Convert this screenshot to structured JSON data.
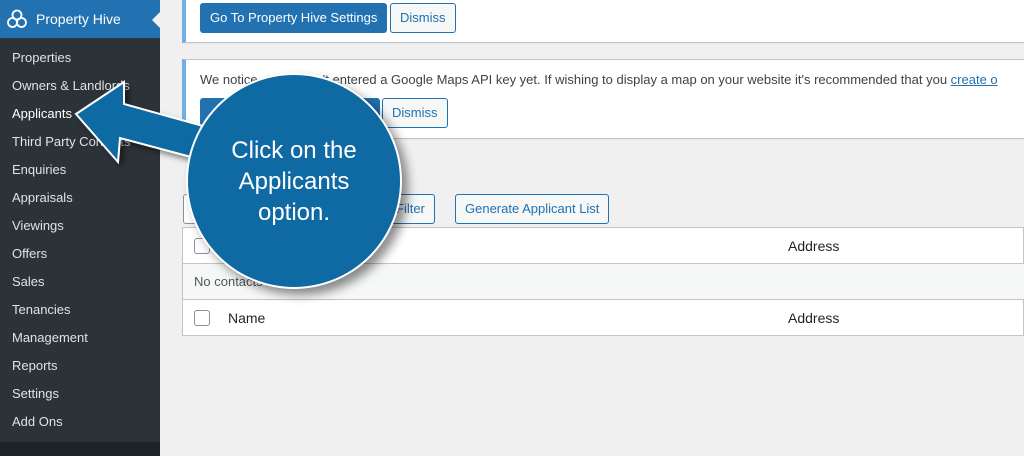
{
  "sidebar": {
    "title": "Property Hive",
    "items": [
      {
        "label": "Properties"
      },
      {
        "label": "Owners & Landlords"
      },
      {
        "label": "Applicants"
      },
      {
        "label": "Third Party Contacts"
      },
      {
        "label": "Enquiries"
      },
      {
        "label": "Appraisals"
      },
      {
        "label": "Viewings"
      },
      {
        "label": "Offers"
      },
      {
        "label": "Sales"
      },
      {
        "label": "Tenancies"
      },
      {
        "label": "Management"
      },
      {
        "label": "Reports"
      },
      {
        "label": "Settings"
      },
      {
        "label": "Add Ons"
      }
    ]
  },
  "notice1": {
    "settings_button": "Go To Property Hive Settings",
    "dismiss_button": "Dismiss"
  },
  "notice2": {
    "text_start": "We notice",
    "text_mid": "n't entered a Google Maps API key yet. If wishing to display a map on your website it's recommended that you",
    "link": "create o",
    "dismiss_button": "Dismiss"
  },
  "filters": {
    "filter_button": "Filter",
    "generate_button": "Generate Applicant List"
  },
  "table": {
    "header": {
      "address": "Address"
    },
    "empty_message": "No contacts found",
    "footer": {
      "name": "Name",
      "address": "Address"
    }
  },
  "callout": {
    "text": "Click on the Applicants option."
  },
  "colors": {
    "sidebar_bg": "#1d2327",
    "submenu_bg": "#2c3338",
    "accent": "#2271b1",
    "callout": "#0f6aa3"
  }
}
